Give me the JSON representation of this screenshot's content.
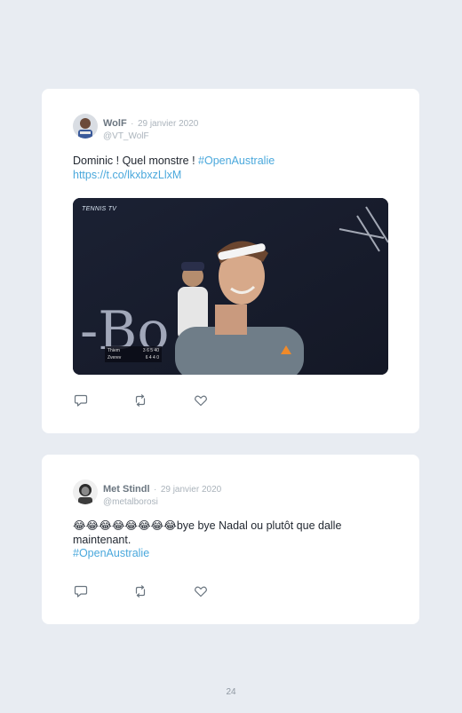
{
  "tweets": [
    {
      "author": "WolF",
      "date": "29 janvier 2020",
      "handle": "@VT_WolF",
      "text": "Dominic ! Quel monstre ! ",
      "hashtag": "#OpenAustralie",
      "link": "https://t.co/lkxbxzLlxM",
      "media_label": "TENNIS TV",
      "scoreboard": {
        "row1": {
          "player": "Thiem",
          "score": "3 6 5 40"
        },
        "row2": {
          "player": "Zverev",
          "score": "6 4 4 0"
        }
      }
    },
    {
      "author": "Met Stindl",
      "date": "29 janvier 2020",
      "handle": "@metalborosi",
      "text": "😂😂😂😂😂😂😂😂bye bye Nadal ou plutôt que dalle maintenant.",
      "hashtag": "#OpenAustralie"
    }
  ],
  "separator": "·",
  "icons": {
    "reply": "reply-icon",
    "retweet": "retweet-icon",
    "like": "heart-icon"
  },
  "colors": {
    "background": "#e8ecf2",
    "card": "#ffffff",
    "link": "#4aa8dc",
    "meta": "#aab3bb"
  },
  "page_number": "24"
}
